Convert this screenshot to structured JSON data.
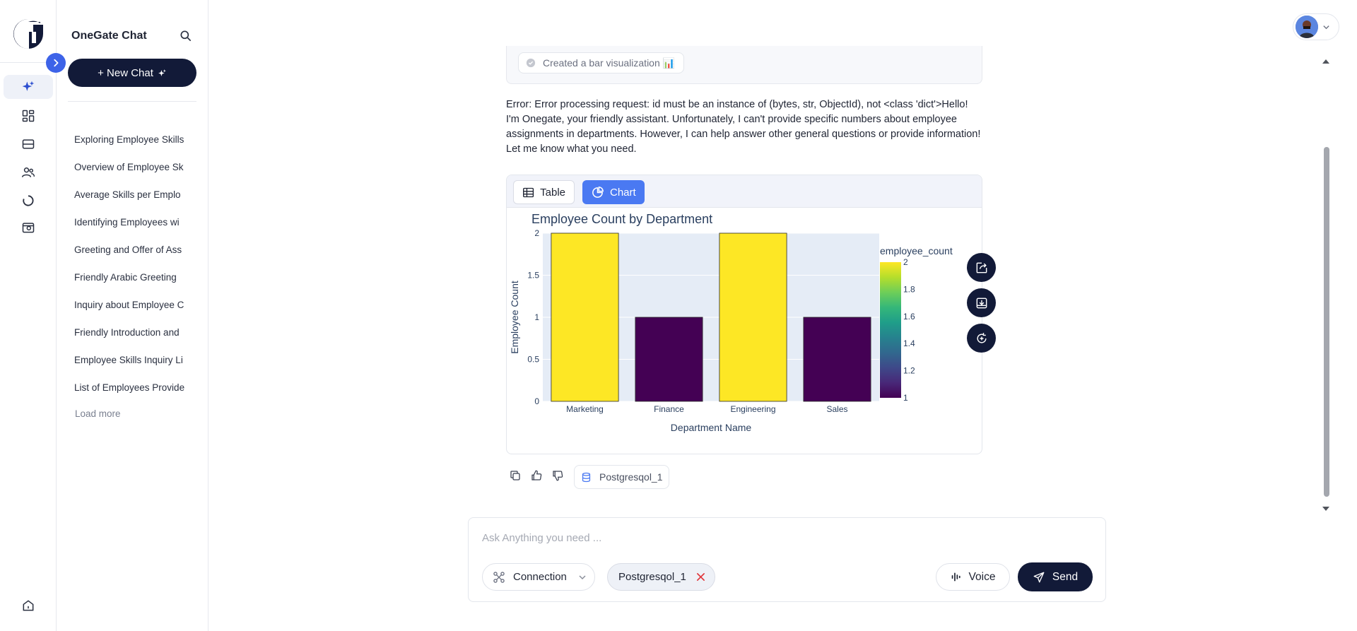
{
  "app": {
    "panel_title": "OneGate Chat",
    "new_chat_label": "+ New Chat"
  },
  "colors": {
    "brand_dark": "#121a38",
    "accent_blue": "#4a79f2",
    "collapse_blue": "#3d63e8"
  },
  "rail_icons": [
    "sparkles-icon",
    "dashboard-icon",
    "database-icon",
    "users-icon",
    "loader-icon",
    "wallet-icon",
    "home-icon"
  ],
  "chat_history": [
    "Exploring Employee Skills",
    "Overview of Employee Sk",
    "Average Skills per Emplo",
    "Identifying Employees wi",
    "Greeting and Offer of Ass",
    "Friendly Arabic Greeting",
    "Inquiry about Employee C",
    "Friendly Introduction and",
    "Employee Skills Inquiry Li",
    "List of Employees Provide"
  ],
  "load_more": "Load more",
  "status": {
    "text": "Created a bar visualization 📊"
  },
  "response": {
    "text": "Error: Error processing request: id must be an instance of (bytes, str, ObjectId), not <class 'dict'>Hello! I'm Onegate, your friendly assistant. Unfortunately, I can't provide specific numbers about employee assignments in departments. However, I can help answer other general questions or provide information! Let me know what you need."
  },
  "chart_tabs": {
    "table": "Table",
    "chart": "Chart",
    "active": "Chart"
  },
  "chart_data": {
    "type": "bar",
    "title": "Employee Count by Department",
    "xlabel": "Department Name",
    "ylabel": "Employee Count",
    "categories": [
      "Marketing",
      "Finance",
      "Engineering",
      "Sales"
    ],
    "values": [
      2,
      1,
      2,
      1
    ],
    "ylim": [
      0,
      2
    ],
    "yticks": [
      "0",
      "0.5",
      "1",
      "1.5",
      "2"
    ],
    "colorscale": "viridis",
    "colorbar": {
      "title": "employee_count",
      "range": [
        1,
        2
      ],
      "ticks": [
        "1",
        "1.2",
        "1.4",
        "1.6",
        "1.8",
        "2"
      ]
    },
    "grid": true,
    "legend": "right"
  },
  "source_chip": "Postgresqol_1",
  "composer": {
    "placeholder": "Ask Anything you need ...",
    "connection_label": "Connection",
    "connection_chip": "Postgresqol_1",
    "voice_label": "Voice",
    "send_label": "Send"
  }
}
